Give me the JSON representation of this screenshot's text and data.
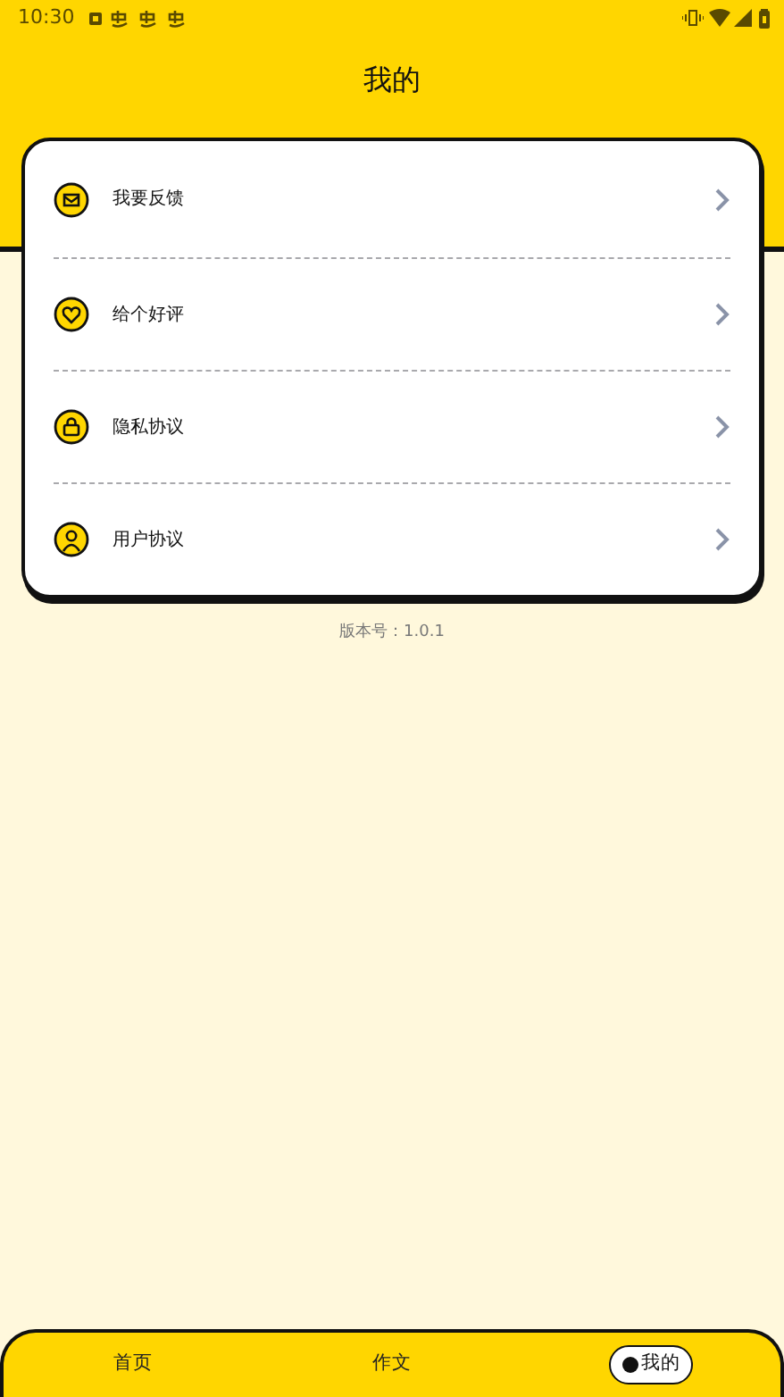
{
  "status_bar": {
    "time": "10:30"
  },
  "header": {
    "title": "我的"
  },
  "menu": [
    {
      "label": "我要反馈"
    },
    {
      "label": "给个好评"
    },
    {
      "label": "隐私协议"
    },
    {
      "label": "用户协议"
    }
  ],
  "version": "版本号：1.0.1",
  "bottom_nav": [
    {
      "label": "首页",
      "selected": false
    },
    {
      "label": "作文",
      "selected": false
    },
    {
      "label": "我的",
      "selected": true
    }
  ]
}
